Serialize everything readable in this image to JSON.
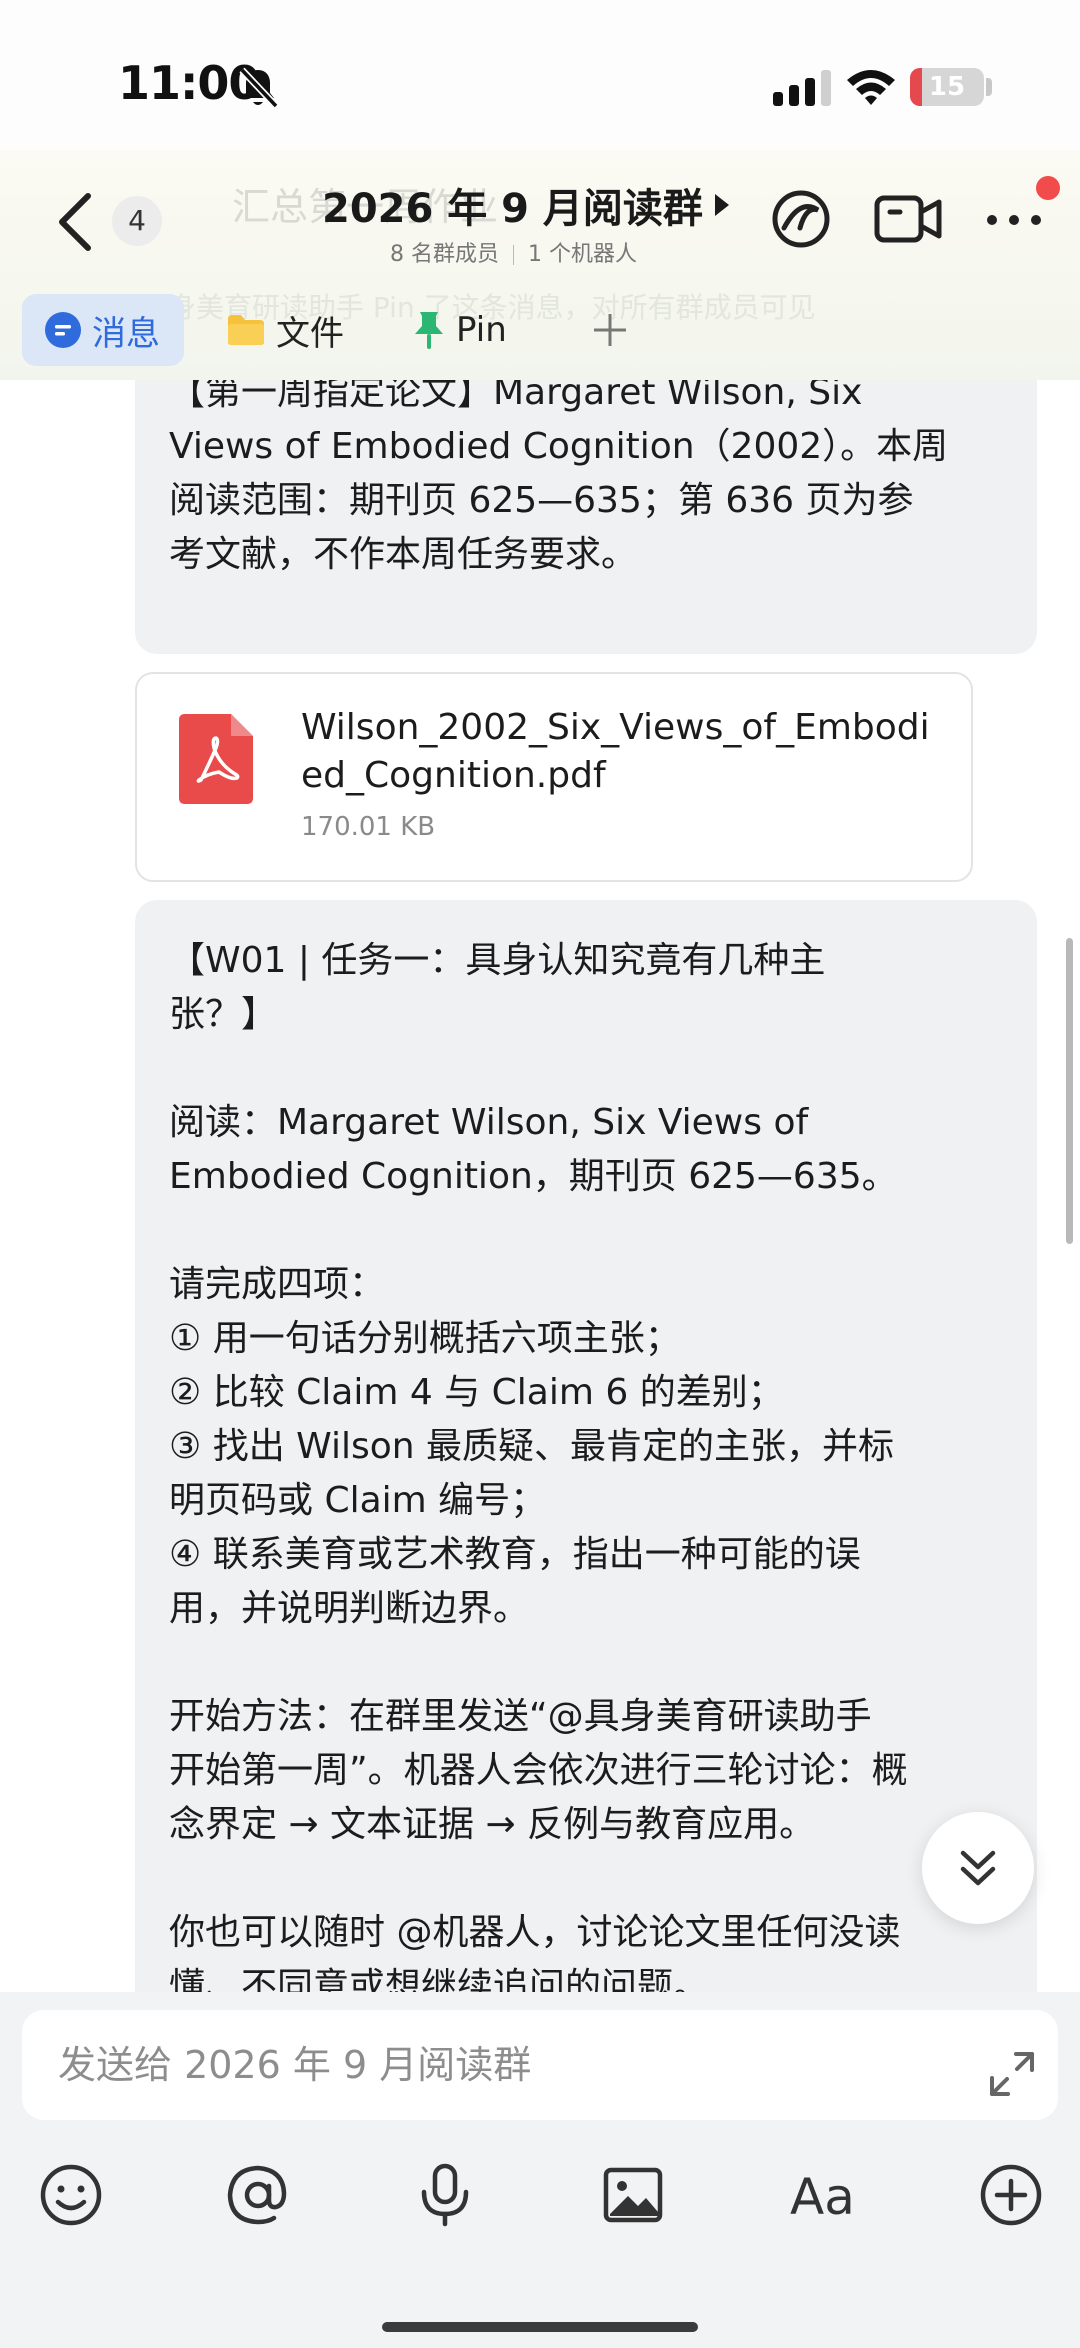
{
  "status_bar": {
    "time": "11:00",
    "battery": "15"
  },
  "header": {
    "unread_count": "4",
    "ghost_title": "汇总第一周作业",
    "title": "2026 年 9 月阅读群",
    "members": "8 名群成员",
    "bots": "1 个机器人",
    "ghost_banner": "具身美育研读助手 Pin 了这条消息，对所有群成员可见"
  },
  "tabs": [
    {
      "label": "消息",
      "icon": "message-icon"
    },
    {
      "label": "文件",
      "icon": "folder-icon"
    },
    {
      "label": "Pin",
      "icon": "pin-icon"
    },
    {
      "label": "",
      "icon": "plus-icon"
    }
  ],
  "messages": {
    "first": "【第一周指定论文】Margaret Wilson, Six\nViews of Embodied Cognition（2002）。本周\n阅读范围：期刊页 625—635；第 636 页为参\n考文献，不作本周任务要求。",
    "file": {
      "name": "Wilson_2002_Six_Views_of_Embodied_Cognition.pdf",
      "size": "170.01 KB"
    },
    "task_lines": [
      "【W01 | 任务一：具身认知究竟有几种主",
      "张？】",
      "",
      "阅读：Margaret Wilson, Six Views of",
      "Embodied Cognition，期刊页 625—635。",
      "",
      "请完成四项：",
      "① 用一句话分别概括六项主张；",
      "② 比较 Claim 4 与 Claim 6 的差别；",
      "③ 找出 Wilson 最质疑、最肯定的主张，并标",
      "明页码或 Claim 编号；",
      "④ 联系美育或艺术教育，指出一种可能的误",
      "用，并说明判断边界。",
      "",
      "开始方法：在群里发送“@具身美育研读助手",
      "开始第一周”。机器人会依次进行三轮讨论：概",
      "念界定 → 文本证据 → 反例与教育应用。",
      "",
      "你也可以随时 @机器人，讨论论文里任何没读",
      "懂、不同意或想继续追问的问题。"
    ]
  },
  "input": {
    "placeholder": "发送给 2026 年 9 月阅读群"
  },
  "toolbar": {
    "font_label": "Aa"
  },
  "colors": {
    "accent_blue": "#2f6bdc",
    "pdf_red": "#e94b4b",
    "pin_green": "#2bb673",
    "folder_yellow": "#f7c23b"
  }
}
